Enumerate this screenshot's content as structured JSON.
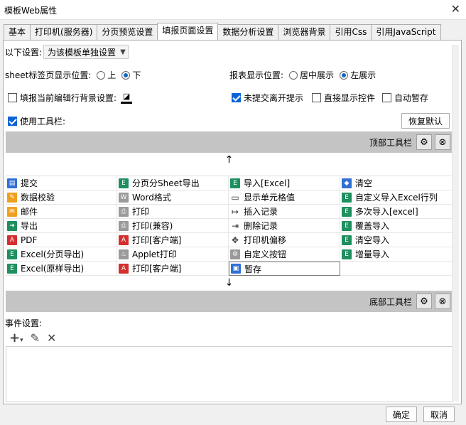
{
  "window": {
    "title": "模板Web属性",
    "close_glyph": "✕"
  },
  "tabs": [
    "基本",
    "打印机(服务器)",
    "分页预览设置",
    "填报页面设置",
    "数据分析设置",
    "浏览器背景",
    "引用Css",
    "引用JavaScript"
  ],
  "settings": {
    "following_label": "以下设置:",
    "following_value": "为该模板单独设置",
    "sheet_tab_label": "sheet标签页显示位置:",
    "sheet_top": "上",
    "sheet_bottom": "下",
    "report_pos_label": "报表显示位置:",
    "report_center": "居中展示",
    "report_left": "左展示",
    "fill_bg_label": "填报当前编辑行背景设置:",
    "unsubmitted_label": "未提交离开提示",
    "direct_display_label": "直接显示控件",
    "autosave_label": "自动暂存",
    "use_toolbar_label": "使用工具栏:",
    "restore_default": "恢复默认"
  },
  "top_toolbar": {
    "label": "顶部工具栏"
  },
  "bottom_toolbar": {
    "label": "底部工具栏"
  },
  "grid_items": [
    [
      {
        "label": "提交",
        "icon": "submit-icon",
        "c": "blue"
      },
      {
        "label": "分页分Sheet导出",
        "icon": "excel-icon",
        "c": "green"
      },
      {
        "label": "导入[Excel]",
        "icon": "excel-icon",
        "c": "green"
      },
      {
        "label": "清空",
        "icon": "eraser-icon",
        "c": "blue"
      }
    ],
    [
      {
        "label": "数据校验",
        "icon": "pencil-icon",
        "c": "orange"
      },
      {
        "label": "Word格式",
        "icon": "word-icon",
        "c": "gray"
      },
      {
        "label": "显示单元格值",
        "icon": "cell-icon",
        "c": "plain"
      },
      {
        "label": "自定义导入Excel行列",
        "icon": "excel-icon",
        "c": "green"
      }
    ],
    [
      {
        "label": "邮件",
        "icon": "mail-icon",
        "c": "orange"
      },
      {
        "label": "打印",
        "icon": "print-icon",
        "c": "gray"
      },
      {
        "label": "插入记录",
        "icon": "insert-icon",
        "c": "plain"
      },
      {
        "label": "多次导入[excel]",
        "icon": "excel-icon",
        "c": "green"
      }
    ],
    [
      {
        "label": "导出",
        "icon": "export-icon",
        "c": "green"
      },
      {
        "label": "打印(兼容)",
        "icon": "print-icon",
        "c": "gray"
      },
      {
        "label": "删除记录",
        "icon": "delete-record-icon",
        "c": "plain"
      },
      {
        "label": "覆盖导入",
        "icon": "excel-icon",
        "c": "green"
      }
    ],
    [
      {
        "label": "PDF",
        "icon": "pdf-icon",
        "c": "red"
      },
      {
        "label": "打印[客户端]",
        "icon": "pdf-icon",
        "c": "red"
      },
      {
        "label": "打印机偏移",
        "icon": "move-icon",
        "c": "plain"
      },
      {
        "label": "清空导入",
        "icon": "excel-icon",
        "c": "green"
      }
    ],
    [
      {
        "label": "Excel(分页导出)",
        "icon": "excel-icon",
        "c": "green"
      },
      {
        "label": "Applet打印",
        "icon": "applet-icon",
        "c": "gray"
      },
      {
        "label": "自定义按钮",
        "icon": "gear-icon",
        "c": "gray"
      },
      {
        "label": "增量导入",
        "icon": "excel-icon",
        "c": "green"
      }
    ],
    [
      {
        "label": "Excel(原样导出)",
        "icon": "excel-icon",
        "c": "green"
      },
      {
        "label": "打印[客户端]",
        "icon": "pdf-icon",
        "c": "red"
      },
      {
        "label": "暂存",
        "icon": "save-icon",
        "c": "blue"
      },
      {
        "label": "",
        "icon": "",
        "c": ""
      }
    ]
  ],
  "events": {
    "label": "事件设置:"
  },
  "footer": {
    "ok": "确定",
    "cancel": "取消"
  }
}
